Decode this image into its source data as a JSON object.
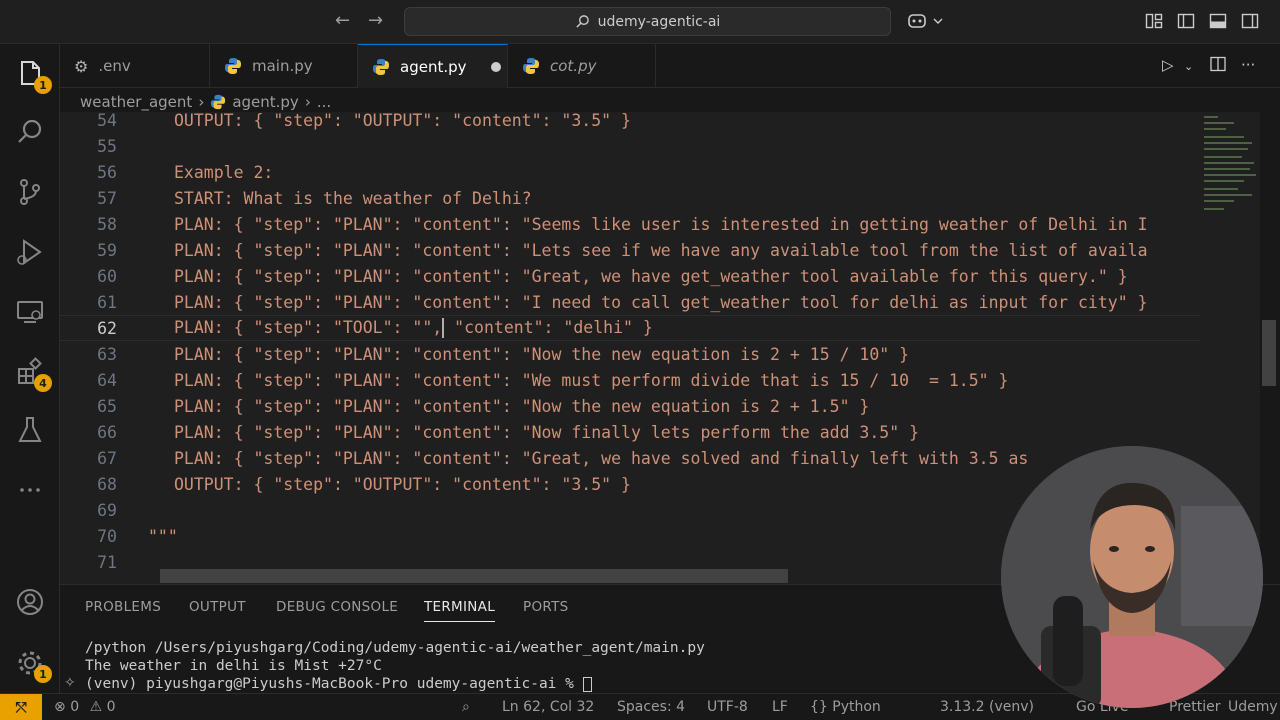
{
  "titlebar": {
    "search": "udemy-agentic-ai"
  },
  "activity": {
    "explorer_badge": "1",
    "extensions_badge": "4",
    "settings_badge": "1"
  },
  "tabs": [
    {
      "label": ".env"
    },
    {
      "label": "main.py"
    },
    {
      "label": "agent.py"
    },
    {
      "label": "cot.py"
    }
  ],
  "breadcrumb": {
    "folder": "weather_agent",
    "file": "agent.py",
    "more": "..."
  },
  "editor": {
    "lines": [
      {
        "n": "54",
        "t": "OUTPUT: { \"step\": \"OUTPUT\": \"content\": \"3.5\" }"
      },
      {
        "n": "55",
        "t": ""
      },
      {
        "n": "56",
        "t": "Example 2:"
      },
      {
        "n": "57",
        "t": "START: What is the weather of Delhi?"
      },
      {
        "n": "58",
        "t": "PLAN: { \"step\": \"PLAN\": \"content\": \"Seems like user is interested in getting weather of Delhi in I"
      },
      {
        "n": "59",
        "t": "PLAN: { \"step\": \"PLAN\": \"content\": \"Lets see if we have any available tool from the list of availa"
      },
      {
        "n": "60",
        "t": "PLAN: { \"step\": \"PLAN\": \"content\": \"Great, we have get_weather tool available for this query.\" }"
      },
      {
        "n": "61",
        "t": "PLAN: { \"step\": \"PLAN\": \"content\": \"I need to call get_weather tool for delhi as input for city\" }"
      },
      {
        "n": "62",
        "t": "PLAN: { \"step\": \"TOOL\": \"\",",
        "t2": " \"content\": \"delhi\" }"
      },
      {
        "n": "63",
        "t": "PLAN: { \"step\": \"PLAN\": \"content\": \"Now the new equation is 2 + 15 / 10\" }"
      },
      {
        "n": "64",
        "t": "PLAN: { \"step\": \"PLAN\": \"content\": \"We must perform divide that is 15 / 10  = 1.5\" }"
      },
      {
        "n": "65",
        "t": "PLAN: { \"step\": \"PLAN\": \"content\": \"Now the new equation is 2 + 1.5\" }"
      },
      {
        "n": "66",
        "t": "PLAN: { \"step\": \"PLAN\": \"content\": \"Now finally lets perform the add 3.5\" }"
      },
      {
        "n": "67",
        "t": "PLAN: { \"step\": \"PLAN\": \"content\": \"Great, we have solved and finally left with 3.5 as"
      },
      {
        "n": "68",
        "t": "OUTPUT: { \"step\": \"OUTPUT\": \"content\": \"3.5\" }"
      },
      {
        "n": "69",
        "t": ""
      },
      {
        "n": "70",
        "t": "\"\"\""
      },
      {
        "n": "71",
        "t": ""
      }
    ]
  },
  "panel": {
    "tabs": [
      "PROBLEMS",
      "OUTPUT",
      "DEBUG CONSOLE",
      "TERMINAL",
      "PORTS"
    ],
    "terminal": [
      "/python /Users/piyushgarg/Coding/udemy-agentic-ai/weather_agent/main.py",
      "The weather in delhi is Mist +27°C",
      "(venv) piyushgarg@Piyushs-MacBook-Pro udemy-agentic-ai % "
    ]
  },
  "statusbar": {
    "errors": "0",
    "warnings": "0",
    "position": "Ln 62, Col 32",
    "spaces": "Spaces: 4",
    "encoding": "UTF-8",
    "eol": "LF",
    "language": "Python",
    "interpreter": "3.13.2 (venv)",
    "golive": "Go Live",
    "prettier": "Prettier",
    "udemy": "Udemy"
  }
}
